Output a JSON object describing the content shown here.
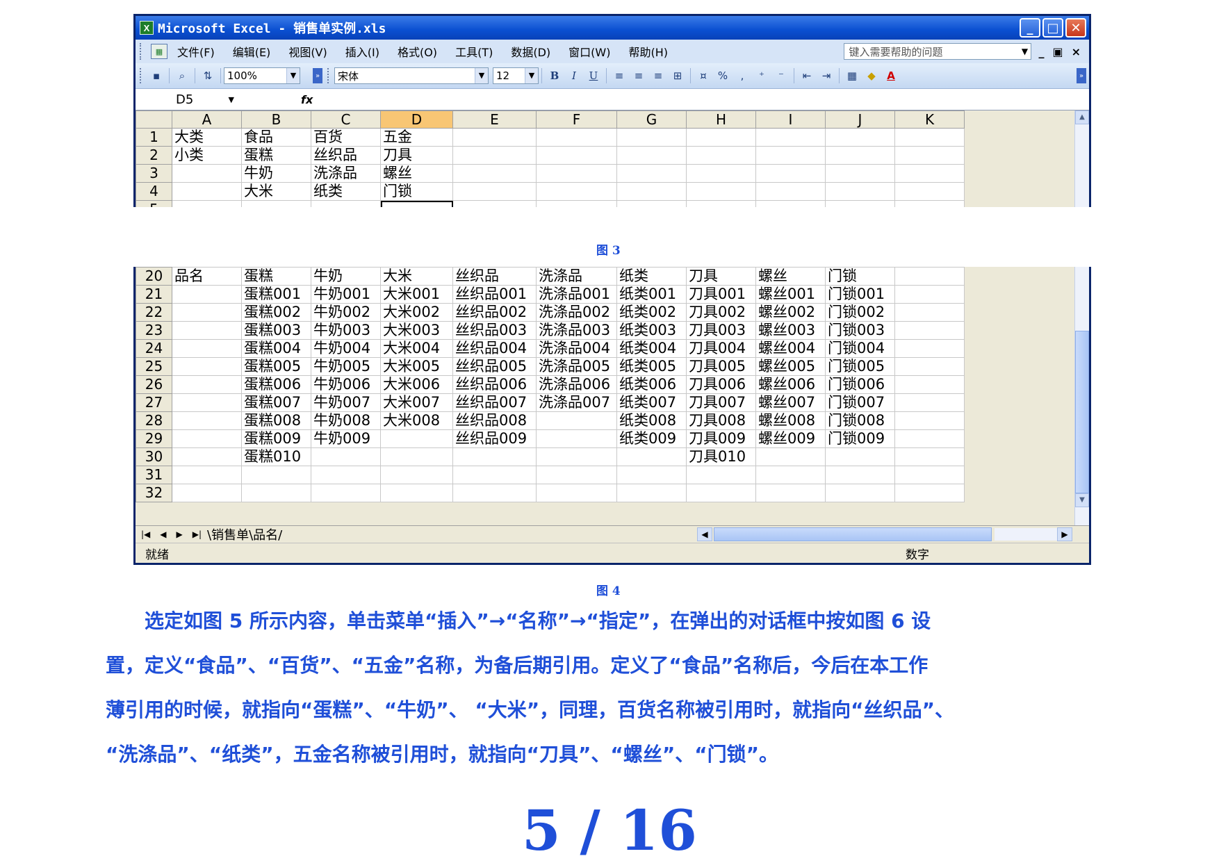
{
  "window": {
    "title": "Microsoft Excel - 销售单实例.xls",
    "app_icon": "X",
    "min_glyph": "_",
    "max_glyph": "□",
    "close_glyph": "✕"
  },
  "menu": {
    "items": [
      "文件(F)",
      "编辑(E)",
      "视图(V)",
      "插入(I)",
      "格式(O)",
      "工具(T)",
      "数据(D)",
      "窗口(W)",
      "帮助(H)"
    ],
    "help_placeholder": "键入需要帮助的问题",
    "ctrl_min": "_",
    "ctrl_restore": "♬",
    "ctrl_close": "×"
  },
  "toolbar": {
    "zoom": "100%",
    "font": "宋体",
    "size": "12",
    "bold": "B",
    "italic": "I",
    "underline": "U",
    "percent": "%",
    "comma": ",",
    "font_color": "A"
  },
  "formula": {
    "name_box": "D5",
    "fx": "fx"
  },
  "columns": [
    "A",
    "B",
    "C",
    "D",
    "E",
    "F",
    "G",
    "H",
    "I",
    "J",
    "K"
  ],
  "top_rows": [
    {
      "n": "1",
      "cells": [
        "大类",
        "食品",
        "百货",
        "五金",
        "",
        "",
        "",
        "",
        "",
        "",
        ""
      ]
    },
    {
      "n": "2",
      "cells": [
        "小类",
        "蛋糕",
        "丝织品",
        "刀具",
        "",
        "",
        "",
        "",
        "",
        "",
        ""
      ]
    },
    {
      "n": "3",
      "cells": [
        "",
        "牛奶",
        "洗涤品",
        "螺丝",
        "",
        "",
        "",
        "",
        "",
        "",
        ""
      ]
    },
    {
      "n": "4",
      "cells": [
        "",
        "大米",
        "纸类",
        "门锁",
        "",
        "",
        "",
        "",
        "",
        "",
        ""
      ]
    },
    {
      "n": "5",
      "cells": [
        "",
        "",
        "",
        "",
        "",
        "",
        "",
        "",
        "",
        "",
        ""
      ]
    }
  ],
  "caption_fig3": "图 3",
  "bottom_rows": [
    {
      "n": "20",
      "cells": [
        "品名",
        "蛋糕",
        "牛奶",
        "大米",
        "丝织品",
        "洗涤品",
        "纸类",
        "刀具",
        "螺丝",
        "门锁",
        ""
      ]
    },
    {
      "n": "21",
      "cells": [
        "",
        "蛋糕001",
        "牛奶001",
        "大米001",
        "丝织品001",
        "洗涤品001",
        "纸类001",
        "刀具001",
        "螺丝001",
        "门锁001",
        ""
      ]
    },
    {
      "n": "22",
      "cells": [
        "",
        "蛋糕002",
        "牛奶002",
        "大米002",
        "丝织品002",
        "洗涤品002",
        "纸类002",
        "刀具002",
        "螺丝002",
        "门锁002",
        ""
      ]
    },
    {
      "n": "23",
      "cells": [
        "",
        "蛋糕003",
        "牛奶003",
        "大米003",
        "丝织品003",
        "洗涤品003",
        "纸类003",
        "刀具003",
        "螺丝003",
        "门锁003",
        ""
      ]
    },
    {
      "n": "24",
      "cells": [
        "",
        "蛋糕004",
        "牛奶004",
        "大米004",
        "丝织品004",
        "洗涤品004",
        "纸类004",
        "刀具004",
        "螺丝004",
        "门锁004",
        ""
      ]
    },
    {
      "n": "25",
      "cells": [
        "",
        "蛋糕005",
        "牛奶005",
        "大米005",
        "丝织品005",
        "洗涤品005",
        "纸类005",
        "刀具005",
        "螺丝005",
        "门锁005",
        ""
      ]
    },
    {
      "n": "26",
      "cells": [
        "",
        "蛋糕006",
        "牛奶006",
        "大米006",
        "丝织品006",
        "洗涤品006",
        "纸类006",
        "刀具006",
        "螺丝006",
        "门锁006",
        ""
      ]
    },
    {
      "n": "27",
      "cells": [
        "",
        "蛋糕007",
        "牛奶007",
        "大米007",
        "丝织品007",
        "洗涤品007",
        "纸类007",
        "刀具007",
        "螺丝007",
        "门锁007",
        ""
      ]
    },
    {
      "n": "28",
      "cells": [
        "",
        "蛋糕008",
        "牛奶008",
        "大米008",
        "丝织品008",
        "",
        "纸类008",
        "刀具008",
        "螺丝008",
        "门锁008",
        ""
      ]
    },
    {
      "n": "29",
      "cells": [
        "",
        "蛋糕009",
        "牛奶009",
        "",
        "丝织品009",
        "",
        "纸类009",
        "刀具009",
        "螺丝009",
        "门锁009",
        ""
      ]
    },
    {
      "n": "30",
      "cells": [
        "",
        "蛋糕010",
        "",
        "",
        "",
        "",
        "",
        "刀具010",
        "",
        "",
        ""
      ]
    },
    {
      "n": "31",
      "cells": [
        "",
        "",
        "",
        "",
        "",
        "",
        "",
        "",
        "",
        "",
        ""
      ]
    },
    {
      "n": "32",
      "cells": [
        "",
        "",
        "",
        "",
        "",
        "",
        "",
        "",
        "",
        "",
        ""
      ]
    }
  ],
  "sheet_tabs": "\\销售单\\品名/",
  "status": {
    "ready": "就绪",
    "mode": "数字"
  },
  "caption_fig4": "图 4",
  "paragraph": {
    "line1": "　　选定如图 5 所示内容，单击菜单“插入”→“名称”→“指定”，在弹出的对话框中按如图 6 设",
    "line2": "置，定义“食品”、“百货”、“五金”名称，为备后期引用。定义了“食品”名称后，今后在本工作",
    "line3": "薄引用的时候，就指向“蛋糕”、“牛奶”、 “大米”，同理，百货名称被引用时，就指向“丝织品”、",
    "line4": " “洗涤品”、“纸类”，五金名称被引用时，就指向“刀具”、“螺丝”、“门锁”。"
  },
  "page_number": "5 / 16"
}
